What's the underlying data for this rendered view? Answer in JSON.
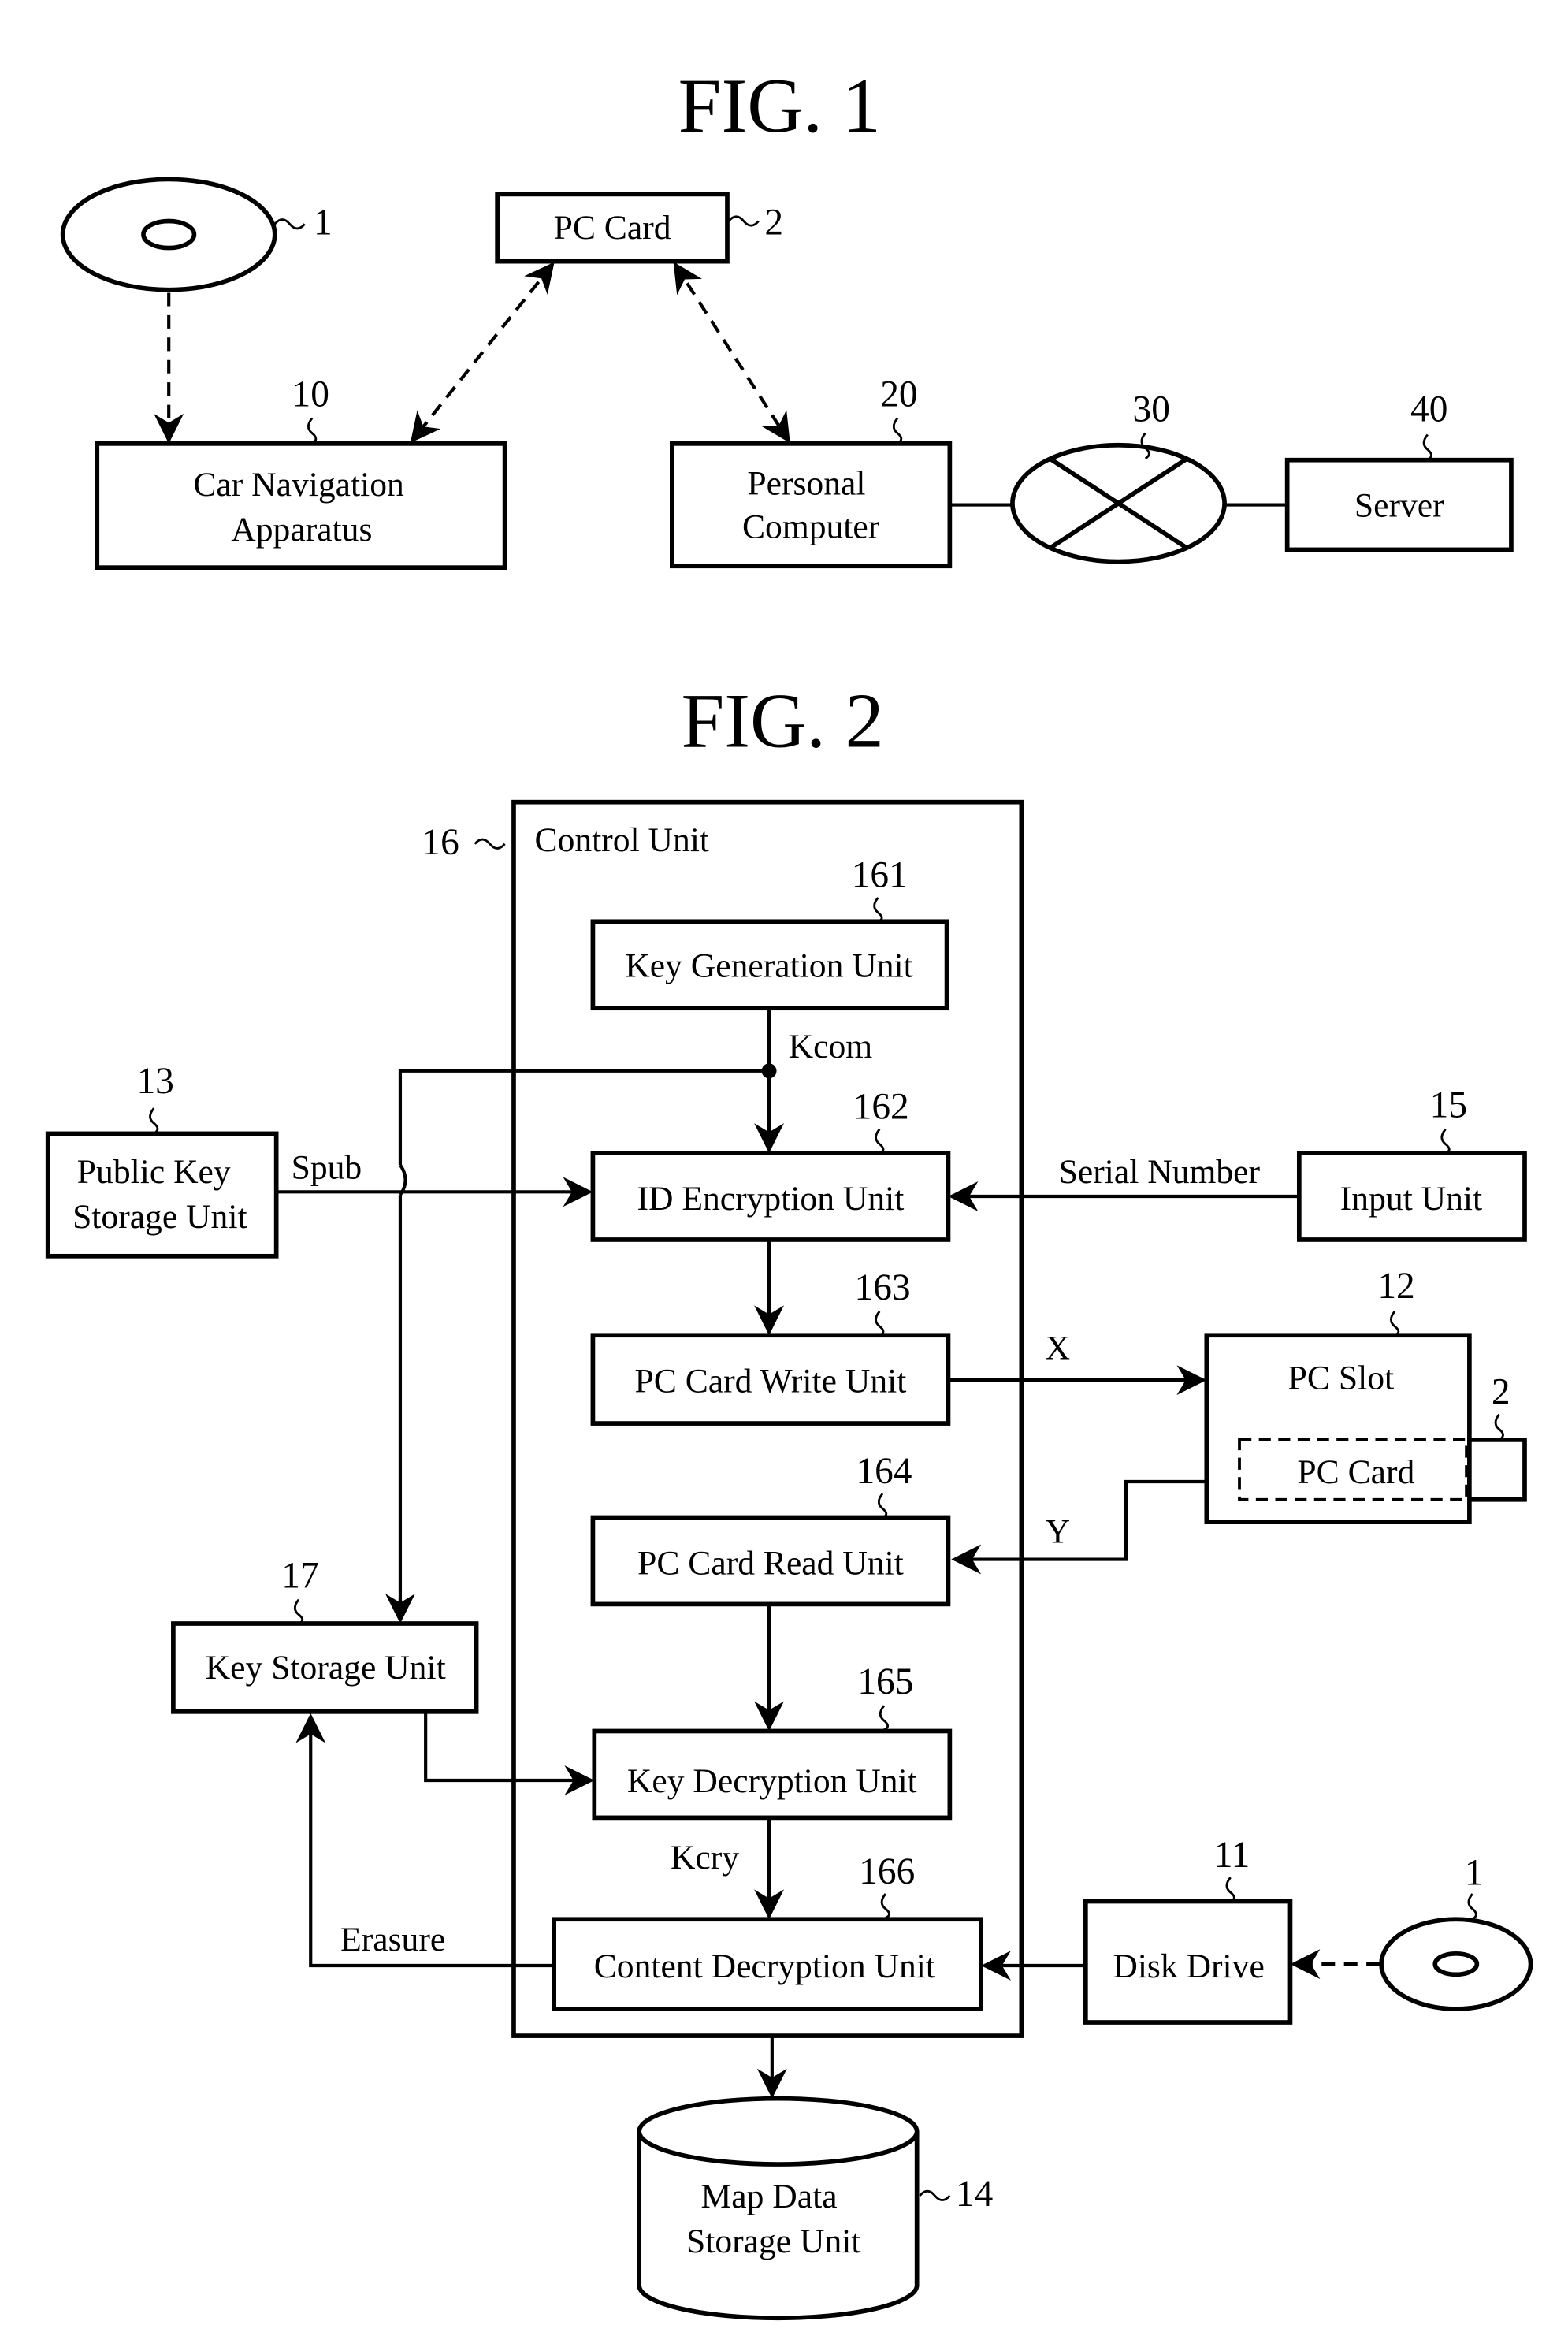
{
  "fig1": {
    "title": "FIG. 1",
    "nodes": {
      "disc": {
        "ref": "1"
      },
      "pc_card": {
        "label": "PC Card",
        "ref": "2"
      },
      "car_nav": {
        "label_line1": "Car Navigation",
        "label_line2": "Apparatus",
        "ref": "10"
      },
      "personal_computer": {
        "label_line1": "Personal",
        "label_line2": "Computer",
        "ref": "20"
      },
      "network": {
        "ref": "30"
      },
      "server": {
        "label": "Server",
        "ref": "40"
      }
    }
  },
  "fig2": {
    "title": "FIG. 2",
    "control_unit": {
      "label": "Control Unit",
      "ref": "16"
    },
    "units": {
      "key_generation": {
        "label": "Key Generation Unit",
        "ref": "161"
      },
      "id_encryption": {
        "label": "ID Encryption Unit",
        "ref": "162"
      },
      "pc_card_write": {
        "label": "PC Card Write Unit",
        "ref": "163"
      },
      "pc_card_read": {
        "label": "PC Card Read Unit",
        "ref": "164"
      },
      "key_decryption": {
        "label": "Key Decryption Unit",
        "ref": "165"
      },
      "content_decryption": {
        "label": "Content Decryption Unit",
        "ref": "166"
      },
      "public_key_storage": {
        "label_line1": "Public Key",
        "label_line2": "Storage Unit",
        "ref": "13"
      },
      "input_unit": {
        "label": "Input Unit",
        "ref": "15"
      },
      "pc_slot": {
        "label": "PC Slot",
        "ref": "12"
      },
      "pc_card": {
        "label": "PC Card",
        "ref": "2"
      },
      "key_storage": {
        "label": "Key Storage Unit",
        "ref": "17"
      },
      "disk_drive": {
        "label": "Disk Drive",
        "ref": "11"
      },
      "disc": {
        "ref": "1"
      },
      "map_data_storage": {
        "label_line1": "Map Data",
        "label_line2": "Storage Unit",
        "ref": "14"
      }
    },
    "signals": {
      "kcom": "Kcom",
      "spub": "Spub",
      "serial_number": "Serial Number",
      "x": "X",
      "y": "Y",
      "kcry": "Kcry",
      "erasure": "Erasure"
    }
  }
}
